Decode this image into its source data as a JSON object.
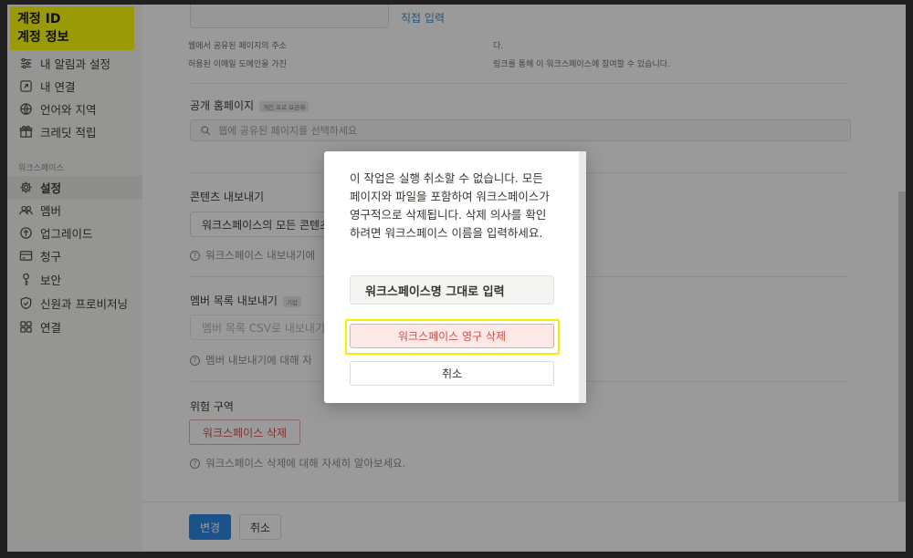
{
  "sidebar": {
    "account_line1": "계정 ID",
    "account_line2": "계정 정보",
    "items_top": [
      {
        "label": "내 알림과 설정",
        "icon": "sliders-icon"
      },
      {
        "label": "내 연결",
        "icon": "link-out-icon"
      },
      {
        "label": "언어와 지역",
        "icon": "globe-icon"
      },
      {
        "label": "크레딧 적립",
        "icon": "gift-icon"
      }
    ],
    "section_label": "워크스페이스",
    "items_workspace": [
      {
        "label": "설정",
        "icon": "gear-icon",
        "active": true
      },
      {
        "label": "멤버",
        "icon": "people-icon"
      },
      {
        "label": "업그레이드",
        "icon": "arrow-up-circle-icon"
      },
      {
        "label": "청구",
        "icon": "card-icon"
      },
      {
        "label": "보안",
        "icon": "key-icon"
      },
      {
        "label": "신원과 프로비저닝",
        "icon": "shield-icon"
      },
      {
        "label": "연결",
        "icon": "grid-icon"
      }
    ]
  },
  "main": {
    "direct_input_link": "직접 입력",
    "domain_text_1": "웹에서 공유된 페이지의 주소",
    "domain_text_1b": "다.",
    "domain_text_2": "허용된 이메일 도메인을 가진",
    "domain_text_2b": "링크를 통해 이 워크스페이스에 참여할 수 있습니다.",
    "public_home": {
      "label": "공개 홈페이지",
      "tag": "개인 프로 요금제",
      "search_placeholder": "웹에 공유된 페이지를 선택하세요"
    },
    "export": {
      "label": "콘텐츠 내보내기",
      "dropdown": "워크스페이스의 모든 콘텐츠",
      "hint": "워크스페이스 내보내기에"
    },
    "member_export": {
      "label": "멤버 목록 내보내기",
      "tag": "기업",
      "button": "멤버 목록 CSV로 내보내기",
      "hint": "멤버 내보내기에 대해 자"
    },
    "danger": {
      "label": "위험 구역",
      "delete_button": "워크스페이스 삭제",
      "hint": "워크스페이스 삭제에 대해 자세히 알아보세요."
    }
  },
  "footer": {
    "save": "변경",
    "cancel": "취소"
  },
  "modal": {
    "message": "이 작업은 실행 취소할 수 없습니다. 모든 페이지와 파일을 포함하여 워크스페이스가 영구적으로 삭제됩니다. 삭제 의사를 확인하려면 워크스페이스 이름을 입력하세요.",
    "input_value": "워크스페이스명 그대로 입력",
    "delete_button": "워크스페이스 영구 삭제",
    "cancel_button": "취소"
  },
  "colors": {
    "accent": "#2383e2",
    "danger": "#d44c47",
    "highlight": "#ffff00"
  }
}
